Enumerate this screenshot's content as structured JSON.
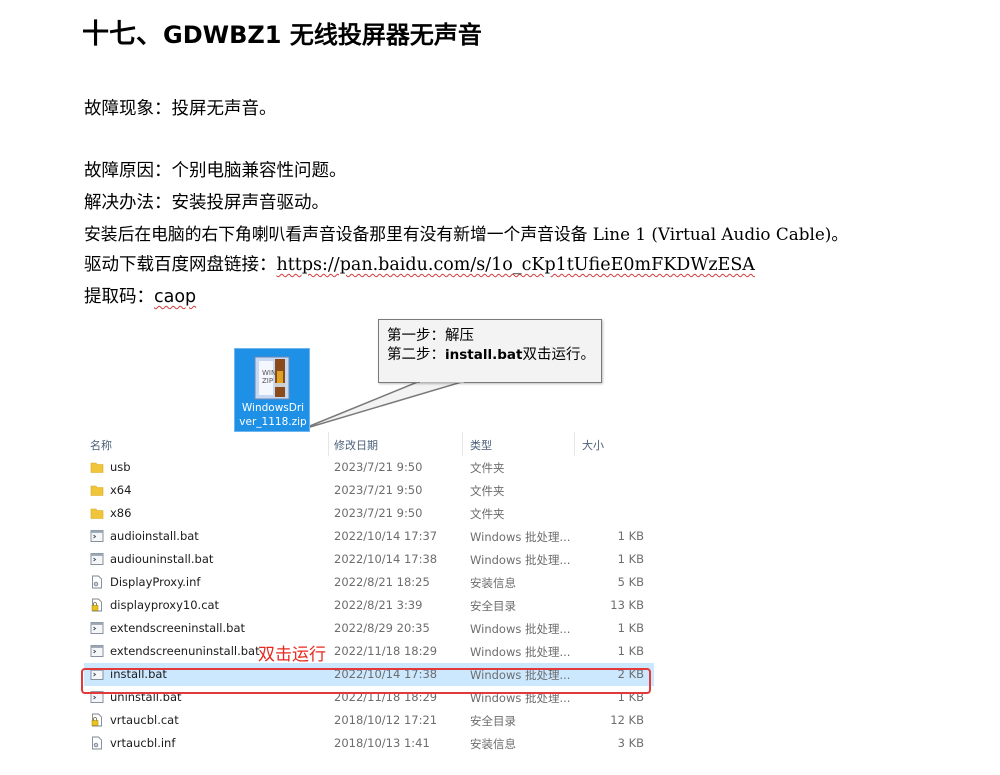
{
  "heading": {
    "number": "十七、",
    "text": "GDWBZ1 无线投屏器无声音"
  },
  "paragraphs": {
    "symptom": "故障现象：投屏无声音。",
    "cause": "故障原因：个别电脑兼容性问题。",
    "solution": "解决办法：安装投屏声音驱动。",
    "check_before": "安装后在电脑的右下角喇叭看声音设备那里有没有新增一个声音设备 ",
    "check_device": "Line 1 (Virtual Audio Cable)",
    "check_after": "。",
    "link_label": "驱动下载百度网盘链接：",
    "link_url": "https://pan.baidu.com/s/1o_cKp1tUfieE0mFKDWzESA",
    "code_label": "提取码：",
    "code": "caop"
  },
  "zip_icon": {
    "name_line1": "WindowsDri",
    "name_line2": "ver_1118.zip",
    "color": "#1e90e6"
  },
  "callout": {
    "step1": "第一步：解压",
    "step2_prefix": "第二步：",
    "step2_file": "install.bat",
    "step2_suffix": "双击运行。"
  },
  "file_list": {
    "headers": {
      "name": "名称",
      "date": "修改日期",
      "type": "类型",
      "size": "大小"
    },
    "rows": [
      {
        "name": "usb",
        "date": "2023/7/21 9:50",
        "type": "文件夹",
        "size": "",
        "icon": "folder-icon"
      },
      {
        "name": "x64",
        "date": "2023/7/21 9:50",
        "type": "文件夹",
        "size": "",
        "icon": "folder-icon"
      },
      {
        "name": "x86",
        "date": "2023/7/21 9:50",
        "type": "文件夹",
        "size": "",
        "icon": "folder-icon"
      },
      {
        "name": "audioinstall.bat",
        "date": "2022/10/14 17:37",
        "type": "Windows 批处理...",
        "size": "1 KB",
        "icon": "batch-file-icon"
      },
      {
        "name": "audiouninstall.bat",
        "date": "2022/10/14 17:38",
        "type": "Windows 批处理...",
        "size": "1 KB",
        "icon": "batch-file-icon"
      },
      {
        "name": "DisplayProxy.inf",
        "date": "2022/8/21 18:25",
        "type": "安装信息",
        "size": "5 KB",
        "icon": "inf-file-icon"
      },
      {
        "name": "displayproxy10.cat",
        "date": "2022/8/21 3:39",
        "type": "安全目录",
        "size": "13 KB",
        "icon": "catalog-file-icon"
      },
      {
        "name": "extendscreeninstall.bat",
        "date": "2022/8/29 20:35",
        "type": "Windows 批处理...",
        "size": "1 KB",
        "icon": "batch-file-icon"
      },
      {
        "name": "extendscreenuninstall.bat",
        "date": "2022/11/18 18:29",
        "type": "Windows 批处理...",
        "size": "1 KB",
        "icon": "batch-file-icon"
      },
      {
        "name": "install.bat",
        "date": "2022/10/14 17:38",
        "type": "Windows 批处理...",
        "size": "2 KB",
        "icon": "batch-file-icon",
        "selected": true
      },
      {
        "name": "uninstall.bat",
        "date": "2022/11/18 18:29",
        "type": "Windows 批处理...",
        "size": "1 KB",
        "icon": "batch-file-icon"
      },
      {
        "name": "vrtaucbl.cat",
        "date": "2018/10/12 17:21",
        "type": "安全目录",
        "size": "12 KB",
        "icon": "catalog-file-icon"
      },
      {
        "name": "vrtaucbl.inf",
        "date": "2018/10/13 1:41",
        "type": "安装信息",
        "size": "3 KB",
        "icon": "inf-file-icon"
      }
    ]
  },
  "annotation": {
    "text": "双击运行",
    "color": "#e8281e"
  },
  "highlight_color": "#e23a3a"
}
